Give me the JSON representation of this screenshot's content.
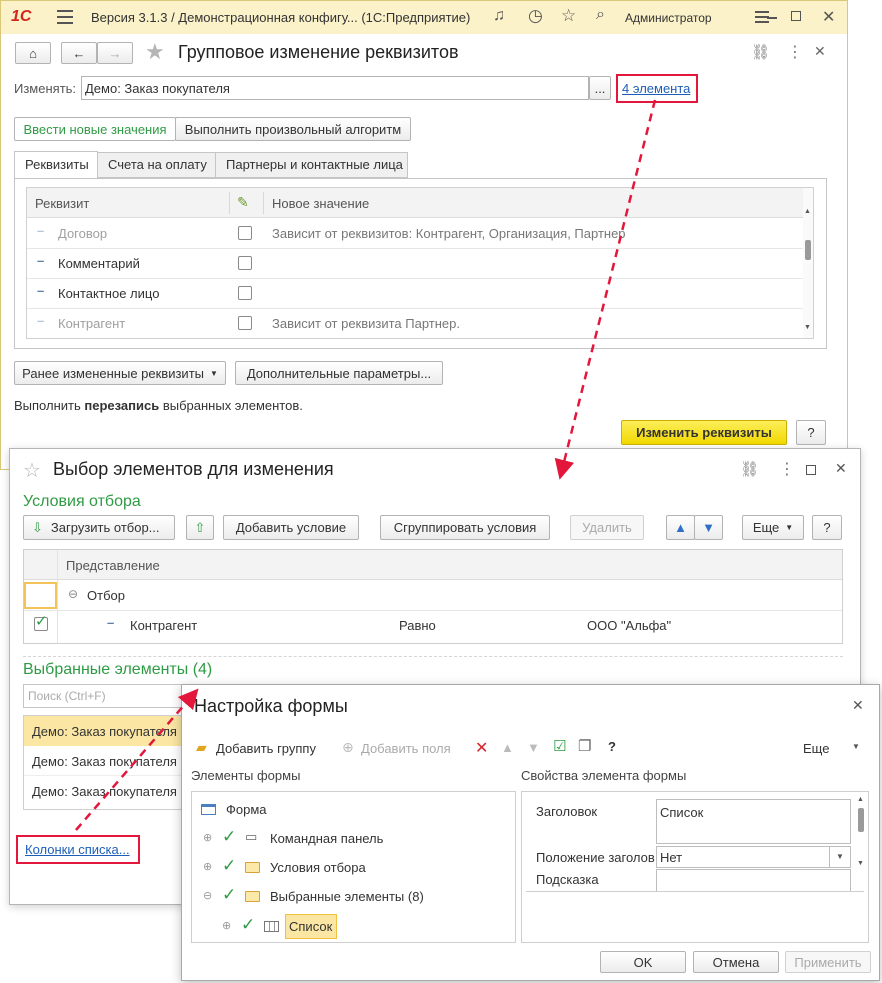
{
  "titlebar": {
    "logo": "1С",
    "title": "Версия 3.1.3 / Демонстрационная конфигу... (1С:Предприятие)",
    "user": "Администратор"
  },
  "main": {
    "title": "Групповое изменение реквизитов",
    "change_label": "Изменять:",
    "change_value": "Демо: Заказ покупателя",
    "browse": "...",
    "elements_link": "4 элемента",
    "mode_tabs": [
      "Ввести новые значения",
      "Выполнить произвольный алгоритм"
    ],
    "tabs": [
      "Реквизиты",
      "Счета на оплату",
      "Партнеры и контактные лица"
    ],
    "table_headers": {
      "attr": "Реквизит",
      "value": "Новое значение"
    },
    "rows": [
      {
        "name": "Договор",
        "value": "Зависит от реквизитов: Контрагент, Организация, Партнер",
        "disabled": true
      },
      {
        "name": "Комментарий",
        "value": "",
        "disabled": false
      },
      {
        "name": "Контактное лицо",
        "value": "",
        "disabled": false
      },
      {
        "name": "Контрагент",
        "value": "Зависит от реквизита Партнер.",
        "disabled": true
      }
    ],
    "prev_changed": "Ранее измененные реквизиты",
    "extra_params": "Дополнительные параметры...",
    "info_prefix": "Выполнить ",
    "info_bold": "перезапись",
    "info_suffix": " выбранных элементов.",
    "change_button": "Изменить реквизиты",
    "help": "?"
  },
  "select_dialog": {
    "title": "Выбор элементов для изменения",
    "filter_section": "Условия отбора",
    "load_filter": "Загрузить отбор...",
    "add_condition": "Добавить условие",
    "group_conditions": "Сгруппировать условия",
    "delete": "Удалить",
    "more": "Еще",
    "help": "?",
    "filter_header": "Представление",
    "filter_group": "Отбор",
    "filter_row": {
      "field": "Контрагент",
      "condition": "Равно",
      "value": "ООО \"Альфа\""
    },
    "selected_section": "Выбранные элементы (4)",
    "search_placeholder": "Поиск (Ctrl+F)",
    "items": [
      "Демо: Заказ покупателя",
      "Демо: Заказ покупателя",
      "Демо: Заказ покупателя"
    ],
    "columns_link": "Колонки списка..."
  },
  "form_settings": {
    "title": "Настройка формы",
    "add_group": "Добавить группу",
    "add_fields": "Добавить поля",
    "help": "?",
    "more": "Еще",
    "elements_label": "Элементы формы",
    "props_label": "Свойства элемента формы",
    "tree": [
      {
        "label": "Форма"
      },
      {
        "label": "Командная панель"
      },
      {
        "label": "Условия отбора"
      },
      {
        "label": "Выбранные элементы (8)"
      },
      {
        "label": "Список"
      }
    ],
    "props": {
      "caption_label": "Заголовок",
      "caption_value": "Список",
      "position_label": "Положение заголов",
      "position_value": "Нет",
      "hint_label": "Подсказка"
    },
    "ok": "OK",
    "cancel": "Отмена",
    "apply": "Применить"
  },
  "colors": {
    "accent_green": "#2f9b44",
    "highlight_red": "#e2173b",
    "primary_yellow": "#f7e51b",
    "selection": "#fbe7a3"
  }
}
